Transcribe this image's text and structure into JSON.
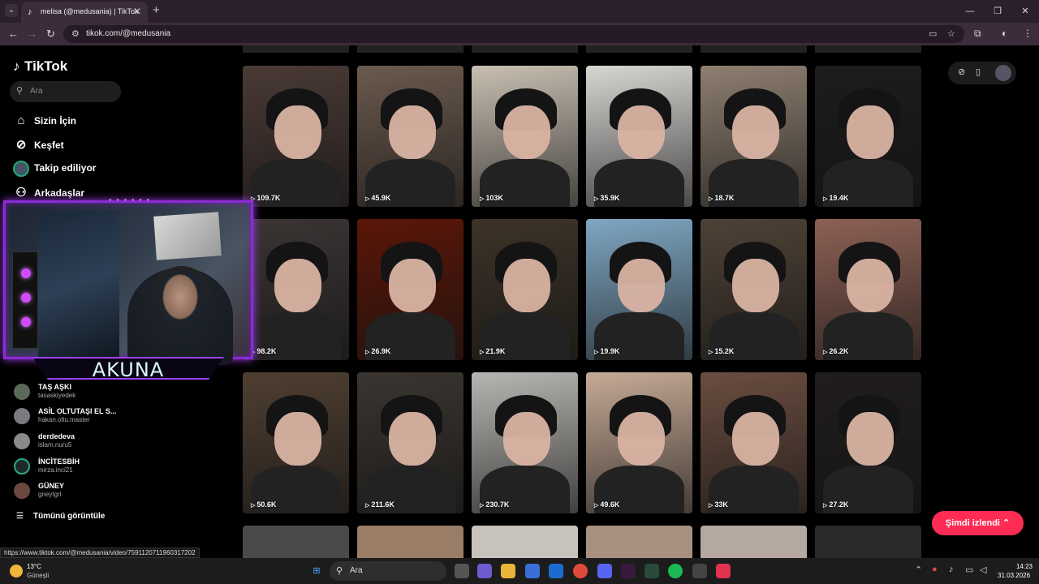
{
  "browser": {
    "tab_title": "melisa (@medusania) | TikTok",
    "tab_close": "✕",
    "new_tab": "+",
    "url": "tikok.com/@medusania",
    "win_min": "—",
    "win_max": "❐",
    "win_close": "✕"
  },
  "tiktok": {
    "logo": "TikTok",
    "search_placeholder": "Ara",
    "nav": [
      {
        "label": "Sizin İçin",
        "icon": "home-icon"
      },
      {
        "label": "Keşfet",
        "icon": "compass-icon"
      },
      {
        "label": "Takip ediliyor",
        "icon": "avatar"
      },
      {
        "label": "Arkadaşlar",
        "icon": "friends-icon"
      }
    ],
    "following_accounts": [
      {
        "name": "TAŞ AŞKI",
        "handle": "tasaskiyedek"
      },
      {
        "name": "ASİL OLTUTAŞI EL S...",
        "handle": "hakan.oltu.master"
      },
      {
        "name": "derdedeva",
        "handle": "islam.nuru5"
      },
      {
        "name": "İNCİTESBİH",
        "handle": "mirza.inci21"
      },
      {
        "name": "GÜNEY",
        "handle": "gneytgrl"
      }
    ],
    "see_all": "Tümünü görüntüle",
    "watched_button": "Şimdi izlendi",
    "hover_link": "https://www.tiktok.com/@medusania/video/7591120711960317202"
  },
  "webcam": {
    "streamer_name": "AKUNA"
  },
  "videos": [
    {
      "views": "109.7K",
      "bg": "#4a3a35"
    },
    {
      "views": "45.9K",
      "bg": "#6b5a4e"
    },
    {
      "views": "103K",
      "bg": "#c9bfb2"
    },
    {
      "views": "35.9K",
      "bg": "#d8d6d3"
    },
    {
      "views": "18.7K",
      "bg": "#8e7f70"
    },
    {
      "views": "19.4K",
      "bg": "#1e1c1c"
    },
    {
      "views": "98.2K",
      "bg": "#3b3534"
    },
    {
      "views": "26.9K",
      "bg": "#5a1608"
    },
    {
      "views": "21.9K",
      "bg": "#3d3328"
    },
    {
      "views": "19.9K",
      "bg": "#7fa7c2"
    },
    {
      "views": "15.2K",
      "bg": "#4e4236"
    },
    {
      "views": "26.2K",
      "bg": "#8d6155"
    },
    {
      "views": "50.6K",
      "bg": "#4f3f32"
    },
    {
      "views": "211.6K",
      "bg": "#3a3530"
    },
    {
      "views": "230.7K",
      "bg": "#b8b6b2"
    },
    {
      "views": "49.6K",
      "bg": "#c6aa96"
    },
    {
      "views": "33K",
      "bg": "#6a4d40"
    },
    {
      "views": "27.2K",
      "bg": "#211d1d"
    }
  ],
  "taskbar": {
    "temp": "13°C",
    "weather": "Güneşli",
    "search": "Ara",
    "time": "14:23",
    "date": "31.03.2026"
  }
}
